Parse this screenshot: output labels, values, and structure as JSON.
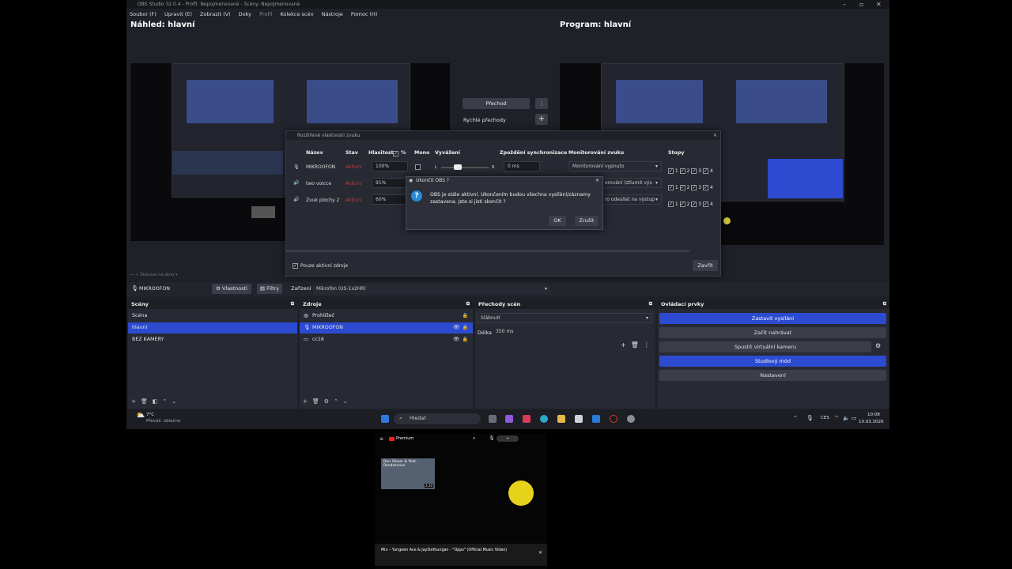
{
  "window": {
    "title": "OBS Studio 32.0.4 - Profil: Nepojmenované - Scény: Nepojmenované",
    "menu": [
      "Soubor (F)",
      "Upravit (E)",
      "Zobrazit (V)",
      "Doky",
      "Profil",
      "Kolekce scén",
      "Nástroje",
      "Pomoc (H)"
    ]
  },
  "preview_header": "Náhled: hlavní",
  "program_header": "Program: hlavní",
  "transition": {
    "button": "Přechod",
    "quick_label": "Rychlé přechody"
  },
  "source_bar": {
    "source_name": "MIKROOFON",
    "properties": "Vlastnosti",
    "filters": "Filtry",
    "device_label": "Zařízení",
    "device_value": "Mikrofon (US-1x2HR)"
  },
  "scenes": {
    "title": "Scény",
    "items": [
      "Scéna",
      "hlavní",
      "BEZ KAMERY"
    ],
    "selected": 1
  },
  "sources": {
    "title": "Zdroje",
    "items": [
      "Prohlížeč",
      "MIKROOFON",
      "cc16"
    ],
    "selected": 1
  },
  "transitions_dock": {
    "title": "Přechody scén",
    "select": "Slábnutí",
    "duration_label": "Délka",
    "duration_value": "350 ms"
  },
  "controls": {
    "title": "Ovládací prvky",
    "buttons": [
      "Zastavit vysílání",
      "Začít nahrávat",
      "Spustit virtuální kameru",
      "Studiový mód",
      "Nastavení"
    ]
  },
  "mixer_dialog": {
    "title": "Rozšířené vlastnosti zvuku",
    "columns": [
      "Název",
      "Stav",
      "Hlasitost",
      "%",
      "Mono",
      "Vyvážení",
      "Zpoždění synchronizace",
      "Monitorování zvuku",
      "Stopy"
    ],
    "rows": [
      {
        "name": "MIKROOFON",
        "status": "Aktivní",
        "volume": "100%",
        "sync": "0 ms",
        "monitor": "Monitorování vypnuto"
      },
      {
        "name": "two voicce",
        "status": "Aktivní",
        "volume": "91%",
        "sync": "",
        "monitor": "orování (ztlumit výs"
      },
      {
        "name": "Zvuk plochy 2",
        "status": "Aktivní",
        "volume": "60%",
        "sync": "",
        "monitor": "ro odesílat na výstup"
      }
    ],
    "balance_left": "L",
    "balance_right": "R",
    "tracks": [
      "1",
      "2",
      "3",
      "4"
    ],
    "active_only": "Pouze aktivní zdroje",
    "close": "Zavřít"
  },
  "quit_modal": {
    "title": "Ukončit OBS ?",
    "message_line1": "OBS je stále aktivní. Ukončením budou všechna vysílání/záznamy",
    "message_line2": "zastavena. Jste si jisti skončit ?",
    "ok": "OK",
    "cancel": "Zrušit"
  },
  "preview_status": "Škálovat na okno",
  "taskbar": {
    "weather_temp": "7°C",
    "weather_text": "Převáž. oblačno",
    "search_placeholder": "Hledat",
    "lang": "CES",
    "time": "10:08",
    "date": "10.03.2026"
  },
  "phone": {
    "brand": "Premium",
    "video_title": "Don Toliver & Yeat - Rendezvous",
    "video_duration": "3:20",
    "mini_player_title": "Mix – Yungeen Ace & JayDaYoungan - \"Opps\" (Official Music Video)"
  }
}
